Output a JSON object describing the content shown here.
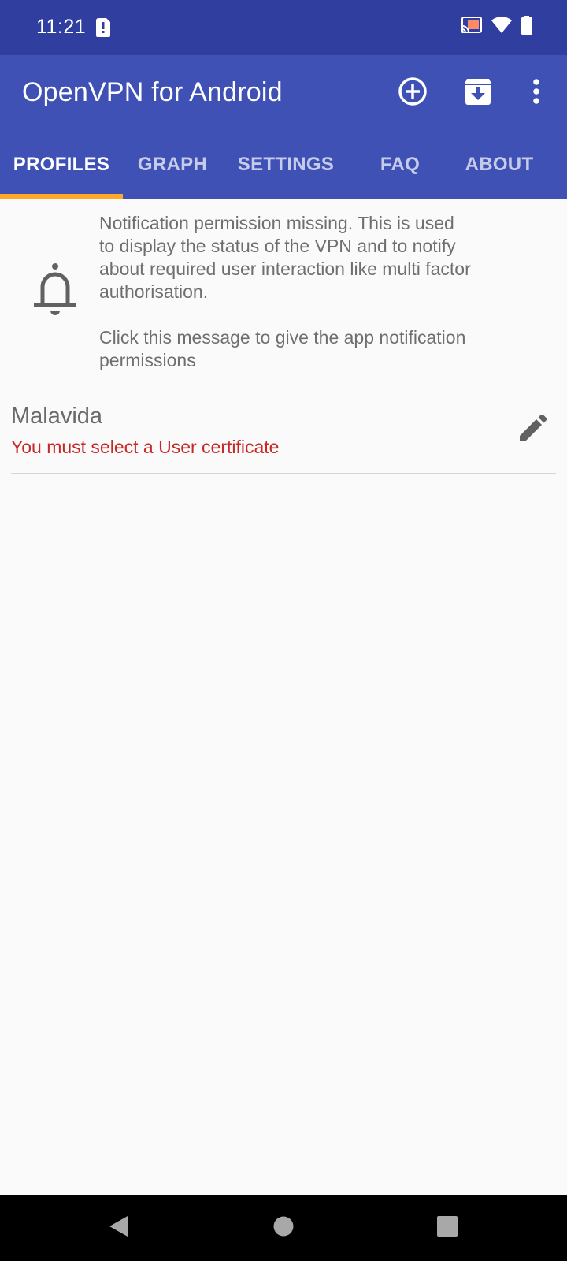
{
  "status_bar": {
    "time": "11:21",
    "icons": [
      "sim-alert-icon",
      "cast-icon",
      "wifi-icon",
      "battery-icon"
    ]
  },
  "app_bar": {
    "title": "OpenVPN for Android",
    "actions": [
      "add-circle-icon",
      "import-archive-icon",
      "more-vert-icon"
    ]
  },
  "tabs": [
    {
      "label": "PROFILES",
      "active": true
    },
    {
      "label": "GRAPH",
      "active": false
    },
    {
      "label": "SETTINGS",
      "active": false
    },
    {
      "label": "FAQ",
      "active": false
    },
    {
      "label": "ABOUT",
      "active": false
    }
  ],
  "notice": {
    "icon": "bell-icon",
    "text": "Notification permission missing. This is used\nto display the status of the VPN and to notify\nabout required user interaction like multi factor\nauthorisation.\n\nClick this message to give the app notification\npermissions"
  },
  "profiles": [
    {
      "name": "Malavida",
      "warning": "You must select a User certificate",
      "icon": "edit-pencil-icon"
    }
  ],
  "nav_bar": {
    "buttons": [
      "back-icon",
      "home-icon",
      "recents-icon"
    ]
  },
  "colors": {
    "status_bar": "#303f9f",
    "primary": "#3f51b5",
    "tab_indicator": "#ffa726",
    "warning": "#c62828",
    "background": "#fafafa"
  }
}
